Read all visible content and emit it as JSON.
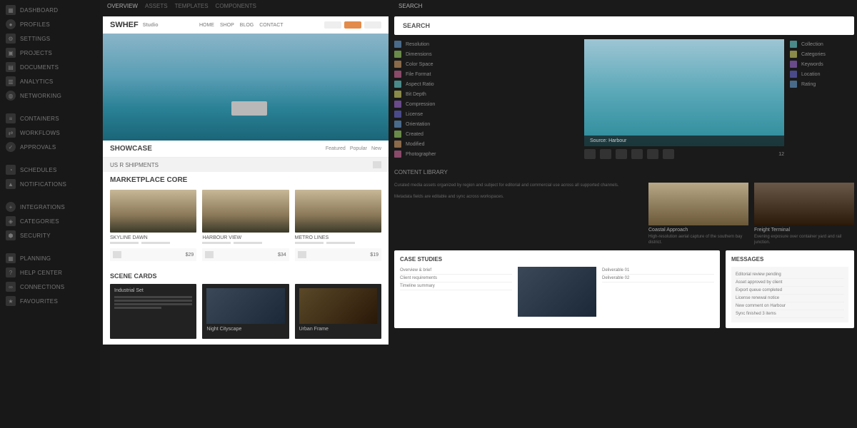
{
  "sidebar": {
    "items": [
      {
        "icon": "grid",
        "label": "Dashboard"
      },
      {
        "icon": "user",
        "label": "Profiles"
      },
      {
        "icon": "gear",
        "label": "Settings"
      },
      {
        "icon": "folder",
        "label": "Projects"
      },
      {
        "icon": "doc",
        "label": "Documents"
      },
      {
        "icon": "chart",
        "label": "Analytics"
      },
      {
        "icon": "globe",
        "label": "Networking"
      }
    ],
    "group2": [
      {
        "icon": "db",
        "label": "Containers"
      },
      {
        "icon": "flow",
        "label": "Workflows"
      },
      {
        "icon": "check",
        "label": "Approvals"
      }
    ],
    "group3": [
      {
        "icon": "clock",
        "label": "Schedules"
      },
      {
        "icon": "bell",
        "label": "Notifications"
      }
    ],
    "group4": [
      {
        "icon": "plus",
        "label": "Integrations"
      },
      {
        "icon": "tag",
        "label": "Categories"
      },
      {
        "icon": "lock",
        "label": "Security"
      }
    ],
    "group5": [
      {
        "icon": "cal",
        "label": "Planning"
      },
      {
        "icon": "help",
        "label": "Help Center"
      },
      {
        "icon": "link",
        "label": "Connections"
      },
      {
        "icon": "star",
        "label": "Favourites"
      }
    ]
  },
  "tabs_left": [
    "Overview",
    "Assets",
    "Templates",
    "Components"
  ],
  "tabs_right": [
    "Search"
  ],
  "preview": {
    "brand": "SWHEF",
    "brand_sub": "Studio",
    "nav": [
      "Home",
      "Shop",
      "Blog",
      "Contact"
    ],
    "section1_title": "Showcase",
    "section1_links": [
      "Featured",
      "Popular",
      "New"
    ],
    "graybar_label": "US R Shipments",
    "cards_title": "Marketplace Core",
    "cards": [
      {
        "title": "Skyline Dawn",
        "price": "$29"
      },
      {
        "title": "Harbour View",
        "price": "$34"
      },
      {
        "title": "Metro Lines",
        "price": "$19"
      }
    ],
    "dark_title": "Scene Cards",
    "dark_cards": [
      {
        "title": "Industrial Set"
      },
      {
        "title": "Night Cityscape"
      },
      {
        "title": "Urban Frame"
      }
    ]
  },
  "right": {
    "search_label": "Search",
    "detail_left": [
      "Resolution",
      "Dimensions",
      "Color Space",
      "File Format",
      "Aspect Ratio",
      "Bit Depth",
      "Compression",
      "License",
      "Orientation",
      "Created",
      "Modified",
      "Photographer"
    ],
    "detail_right": [
      "Collection",
      "Categories",
      "Keywords",
      "Location",
      "Rating"
    ],
    "hero_caption": "Source: Harbour",
    "action_count": "12",
    "section_title": "Content Library",
    "text_block": [
      "Curated media assets organized by region and subject for editorial and commercial use across all supported channels.",
      "Metadata fields are editable and sync across workspaces."
    ],
    "thumbs": [
      {
        "title": "Coastal Approach",
        "meta": "High-resolution aerial capture of the southern bay district."
      },
      {
        "title": "Freight Terminal",
        "meta": "Evening exposure over container yard and rail junction."
      }
    ],
    "bottom_left": {
      "title": "Case Studies",
      "items": [
        "Overview & brief",
        "Client requirements",
        "Timeline summary"
      ],
      "sub_items": [
        "Deliverable 01",
        "Deliverable 02"
      ]
    },
    "bottom_right": {
      "title": "Messages",
      "items": [
        "Editorial review pending",
        "Asset approved by client",
        "Export queue completed",
        "License renewal notice",
        "New comment on Harbour",
        "Sync finished 3 items"
      ]
    }
  }
}
